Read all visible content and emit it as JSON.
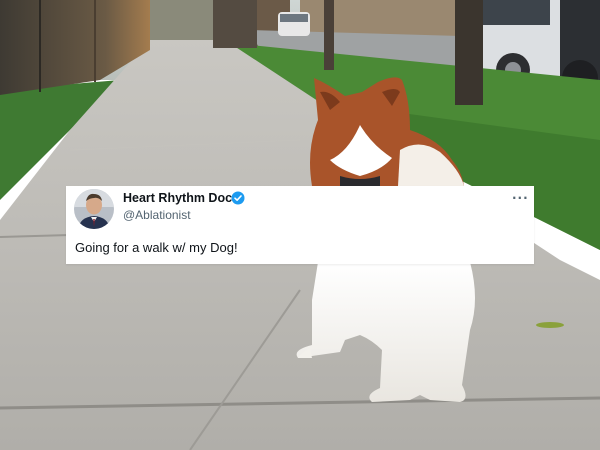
{
  "tweet": {
    "display_name": "Heart Rhythm Doc",
    "handle": "@Ablationist",
    "text": "Going for a walk w/ my Dog!",
    "more_glyph": "···",
    "verified_color": "#1d9bf0"
  },
  "icons": [
    "avatar-photo",
    "verified-badge-icon",
    "more-options-icon"
  ]
}
